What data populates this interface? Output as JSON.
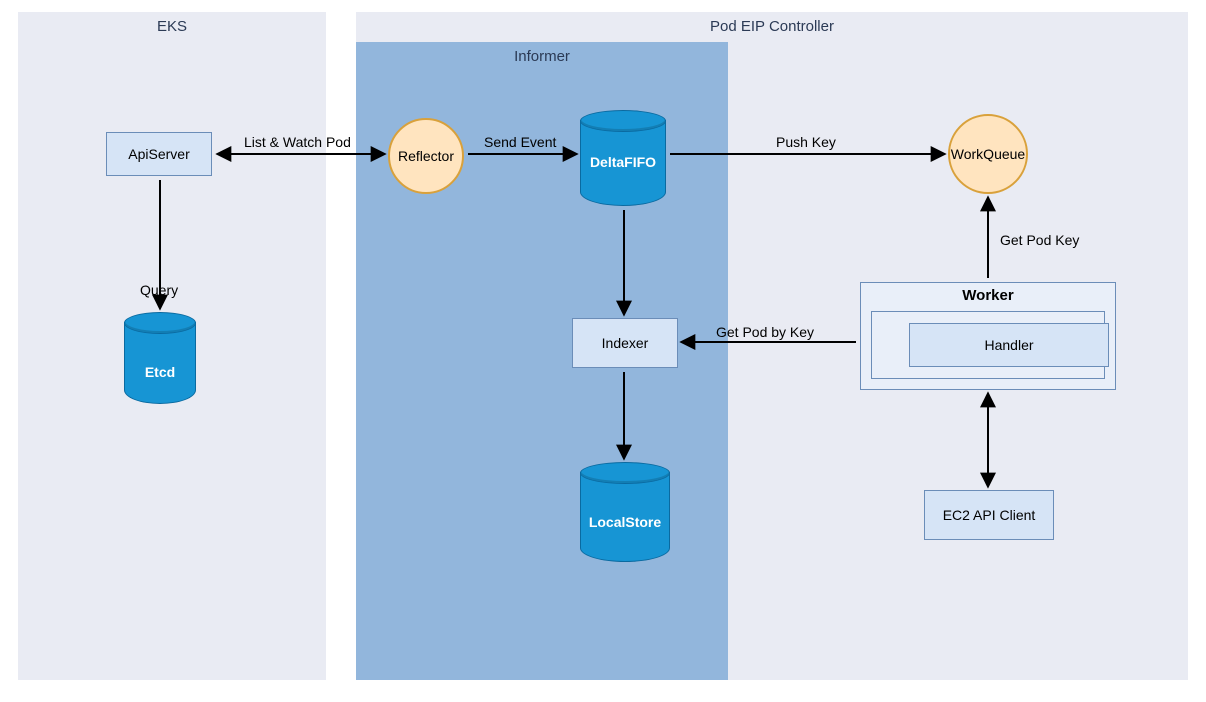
{
  "regions": {
    "eks": {
      "title": "EKS"
    },
    "controller": {
      "title": "Pod EIP Controller"
    },
    "informer": {
      "title": "Informer"
    }
  },
  "nodes": {
    "apiserver": {
      "label": "ApiServer"
    },
    "etcd": {
      "label": "Etcd"
    },
    "reflector": {
      "label": "Reflector"
    },
    "deltafifo": {
      "label": "DeltaFIFO"
    },
    "indexer": {
      "label": "Indexer"
    },
    "localstore": {
      "label": "LocalStore"
    },
    "workqueue": {
      "label": "WorkQueue"
    },
    "worker": {
      "label": "Worker"
    },
    "handler": {
      "label": "Handler"
    },
    "ec2client": {
      "label": "EC2 API Client"
    }
  },
  "edges": {
    "list_watch": {
      "label": "List & Watch Pod"
    },
    "query": {
      "label": "Query"
    },
    "send_event": {
      "label": "Send Event"
    },
    "push_key": {
      "label": "Push Key"
    },
    "get_pod_key": {
      "label": "Get Pod Key"
    },
    "get_pod_by_key": {
      "label": "Get Pod by Key"
    }
  },
  "colors": {
    "region_bg": "#e9ebf3",
    "informer_bg": "#92b6dc",
    "box_fill": "#d6e4f6",
    "box_stroke": "#6b8db8",
    "circle_fill": "#ffe4bf",
    "circle_stroke": "#d9a13b",
    "cylinder_fill": "#1795d4",
    "cylinder_stroke": "#0a6aa0"
  }
}
